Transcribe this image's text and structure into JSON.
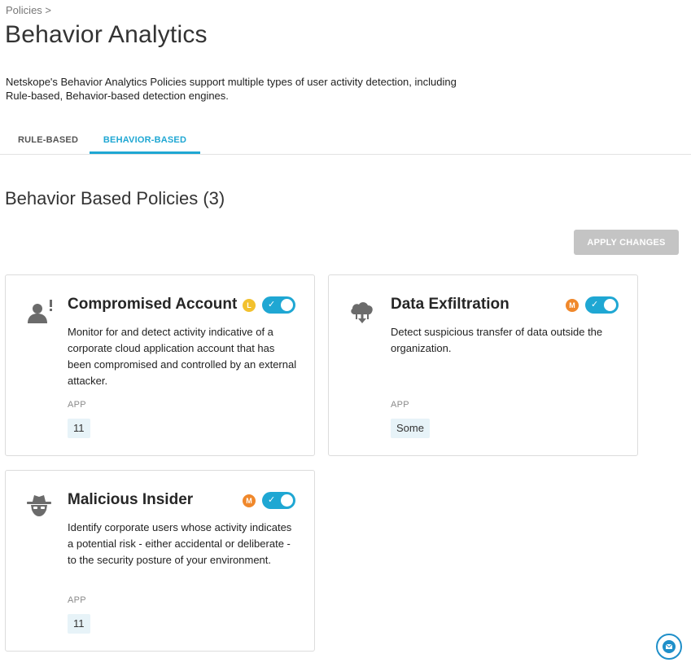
{
  "breadcrumb": "Policies >",
  "page_title": "Behavior Analytics",
  "description": "Netskope's Behavior Analytics Policies support multiple types of user activity detection, including Rule-based, Behavior-based detection engines.",
  "tabs": [
    {
      "label": "RULE-BASED",
      "active": false
    },
    {
      "label": "BEHAVIOR-BASED",
      "active": true
    }
  ],
  "section_title": "Behavior Based Policies (3)",
  "apply_button": "APPLY CHANGES",
  "cards": [
    {
      "title": "Compromised Account",
      "icon": "user-alert-icon",
      "severity": "L",
      "severity_color": "#f2c12e",
      "enabled": true,
      "description": "Monitor for and detect activity indicative of a corporate cloud application account that has been compromised and controlled by an external attacker.",
      "app_label": "APP",
      "app_value": "11"
    },
    {
      "title": "Data Exfiltration",
      "icon": "cloud-download-icon",
      "severity": "M",
      "severity_color": "#f0882b",
      "enabled": true,
      "description": "Detect suspicious transfer of data outside the organization.",
      "app_label": "APP",
      "app_value": "Some"
    },
    {
      "title": "Malicious Insider",
      "icon": "spy-icon",
      "severity": "M",
      "severity_color": "#f0882b",
      "enabled": true,
      "description": "Identify corporate users whose activity indicates a potential risk - either accidental or deliberate - to the security posture of your environment.",
      "app_label": "APP",
      "app_value": "11"
    }
  ],
  "accent_color": "#1fa7d3"
}
